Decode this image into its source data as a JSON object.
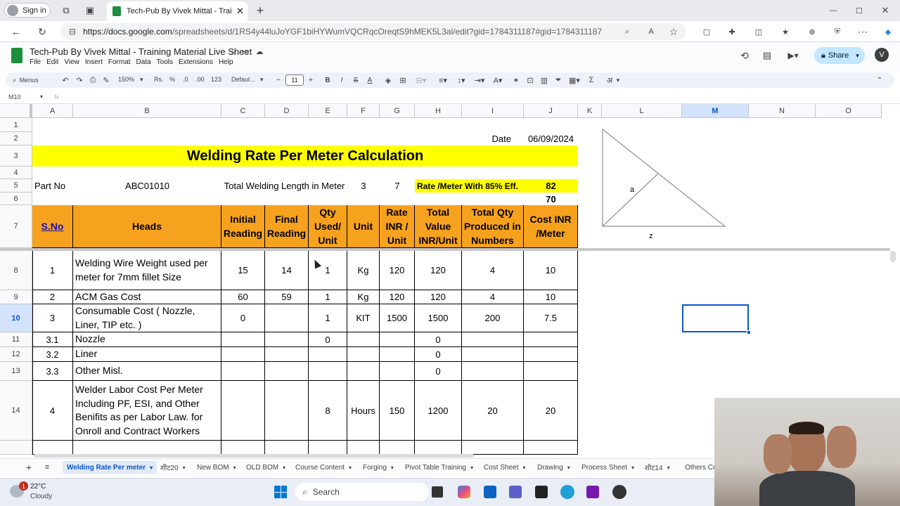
{
  "browser": {
    "signin": "Sign in",
    "tab_title": "Tech-Pub By Vivek Mittal - Trainin",
    "url_host": "https://docs.google.com",
    "url_path": "/spreadsheets/d/1RS4y44luJoYGF1biHYWumVQCRqcOreqtS9hMEK5L3al/edit?gid=1784311187#gid=1784311187"
  },
  "doc": {
    "title": "Tech-Pub By Vivek Mittal - Training Material Live Sheet",
    "menus": [
      "File",
      "Edit",
      "View",
      "Insert",
      "Format",
      "Data",
      "Tools",
      "Extensions",
      "Help"
    ],
    "share": "Share",
    "avatar": "V"
  },
  "toolbar": {
    "menus": "Menus",
    "zoom": "150%",
    "rs": "Rs.",
    "pct": "%",
    "dec_less": ".0",
    "dec_more": ".00",
    "fmt": "123",
    "font": "Defaul...",
    "size": "11",
    "bold": "B",
    "italic": "I",
    "strike": "S",
    "color_a": "A",
    "sigma": "Σ",
    "hindi": "अ"
  },
  "formula": {
    "cell_ref": "M10",
    "fx": "fx"
  },
  "columns": [
    "A",
    "B",
    "C",
    "D",
    "E",
    "F",
    "G",
    "H",
    "I",
    "J",
    "K",
    "L",
    "M",
    "N",
    "O"
  ],
  "rows": [
    "1",
    "2",
    "3",
    "4",
    "5",
    "6",
    "7",
    "8",
    "9",
    "10",
    "11",
    "12",
    "13",
    "14"
  ],
  "sheet": {
    "date_label": "Date",
    "date_value": "06/09/2024",
    "title": "Welding Rate Per Meter Calculation",
    "part_label": "Part No",
    "part_value": "ABC01010",
    "length_label": "Total Welding Length in Meter",
    "length_value": "3",
    "f5": "7",
    "rate_label": "Rate /Meter With 85% Eff.",
    "rate_value": "82",
    "j6": "70",
    "headers": [
      "S.No",
      "Heads",
      "Initial Reading",
      "Final Reading",
      "Qty Used/ Unit",
      "Unit",
      "Rate INR / Unit",
      "Total Value INR/Unit",
      "Total Qty Produced in Numbers",
      "Cost INR /Meter"
    ],
    "data": [
      [
        "1",
        "Welding Wire Weight used per meter for 7mm fillet Size",
        "15",
        "14",
        "1",
        "Kg",
        "120",
        "120",
        "4",
        "10"
      ],
      [
        "2",
        "ACM Gas Cost",
        "60",
        "59",
        "1",
        "Kg",
        "120",
        "120",
        "4",
        "10"
      ],
      [
        "3",
        "Consumable Cost ( Nozzle, Liner, TIP etc. )",
        "0",
        "",
        "1",
        "KIT",
        "1500",
        "1500",
        "200",
        "7.5"
      ],
      [
        "3.1",
        "Nozzle",
        "",
        "",
        "0",
        "",
        "",
        "0",
        "",
        ""
      ],
      [
        "3.2",
        "Liner",
        "",
        "",
        "",
        "",
        "",
        "0",
        "",
        ""
      ],
      [
        "3.3",
        "Other Misl.",
        "",
        "",
        "",
        "",
        "",
        "0",
        "",
        ""
      ],
      [
        "4",
        "Welder Labor Cost Per Meter Including PF, ESI, and Other Benifits as per Labor Law. for Onroll and Contract Workers",
        "",
        "",
        "8",
        "Hours",
        "150",
        "1200",
        "20",
        "20"
      ]
    ],
    "triangle_a": "a",
    "triangle_z": "z"
  },
  "tabs": [
    "Welding Rate Per meter",
    "शीट20",
    "New BOM",
    "OLD BOM",
    "Course Content",
    "Forging",
    "Pivot Table Training",
    "Cost Sheet",
    "Drawing",
    "Process Sheet",
    "शीट14",
    "Others Cos"
  ],
  "taskbar": {
    "badge": "1",
    "temp": "22°C",
    "weather": "Cloudy",
    "search": "Search"
  },
  "colors": {
    "title_fill": "#ffff00",
    "header_fill": "#f6a21e",
    "rate_fill": "#ffff00",
    "accent": "#0b57d0"
  }
}
